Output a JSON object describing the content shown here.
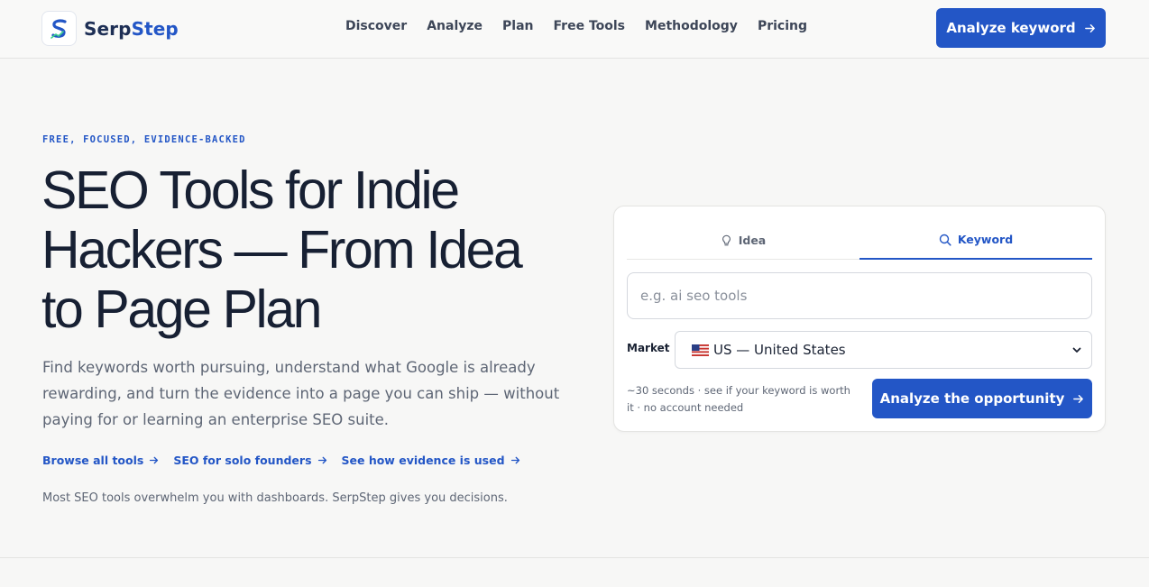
{
  "brand": {
    "name_part1": "Serp",
    "name_part2": "Step",
    "accent_color": "#2356c6",
    "logo_icon": "serpstep-s-logo-icon"
  },
  "nav": {
    "items": [
      "Discover",
      "Analyze",
      "Plan",
      "Free Tools",
      "Methodology",
      "Pricing"
    ]
  },
  "header_cta": {
    "label": "Analyze keyword",
    "icon": "arrow-right-icon"
  },
  "hero": {
    "eyebrow": "FREE, FOCUSED, EVIDENCE-BACKED",
    "title_lines": [
      "SEO Tools for Indie",
      "Hackers — From Idea",
      "to Page Plan"
    ],
    "subtitle": "Find keywords worth pursuing, understand what Google is already rewarding, and turn the evidence into a page you can ship — without paying for or learning an enterprise SEO suite.",
    "links": [
      "Browse all tools",
      "SEO for solo founders",
      "See how evidence is used"
    ],
    "tagline": "Most SEO tools overwhelm you with dashboards. SerpStep gives you decisions."
  },
  "analyzer": {
    "tabs": [
      {
        "label": "Idea",
        "icon": "lightbulb-icon",
        "active": false
      },
      {
        "label": "Keyword",
        "icon": "search-icon",
        "active": true
      }
    ],
    "keyword_placeholder": "e.g. ai seo tools",
    "keyword_value": "",
    "market_label": "Market",
    "market_selected": "US — United States",
    "market_flag": "us-flag-icon",
    "note": "~30 seconds · see if your keyword is worth it · no account needed",
    "submit_label": "Analyze the opportunity",
    "submit_icon": "arrow-right-icon"
  }
}
